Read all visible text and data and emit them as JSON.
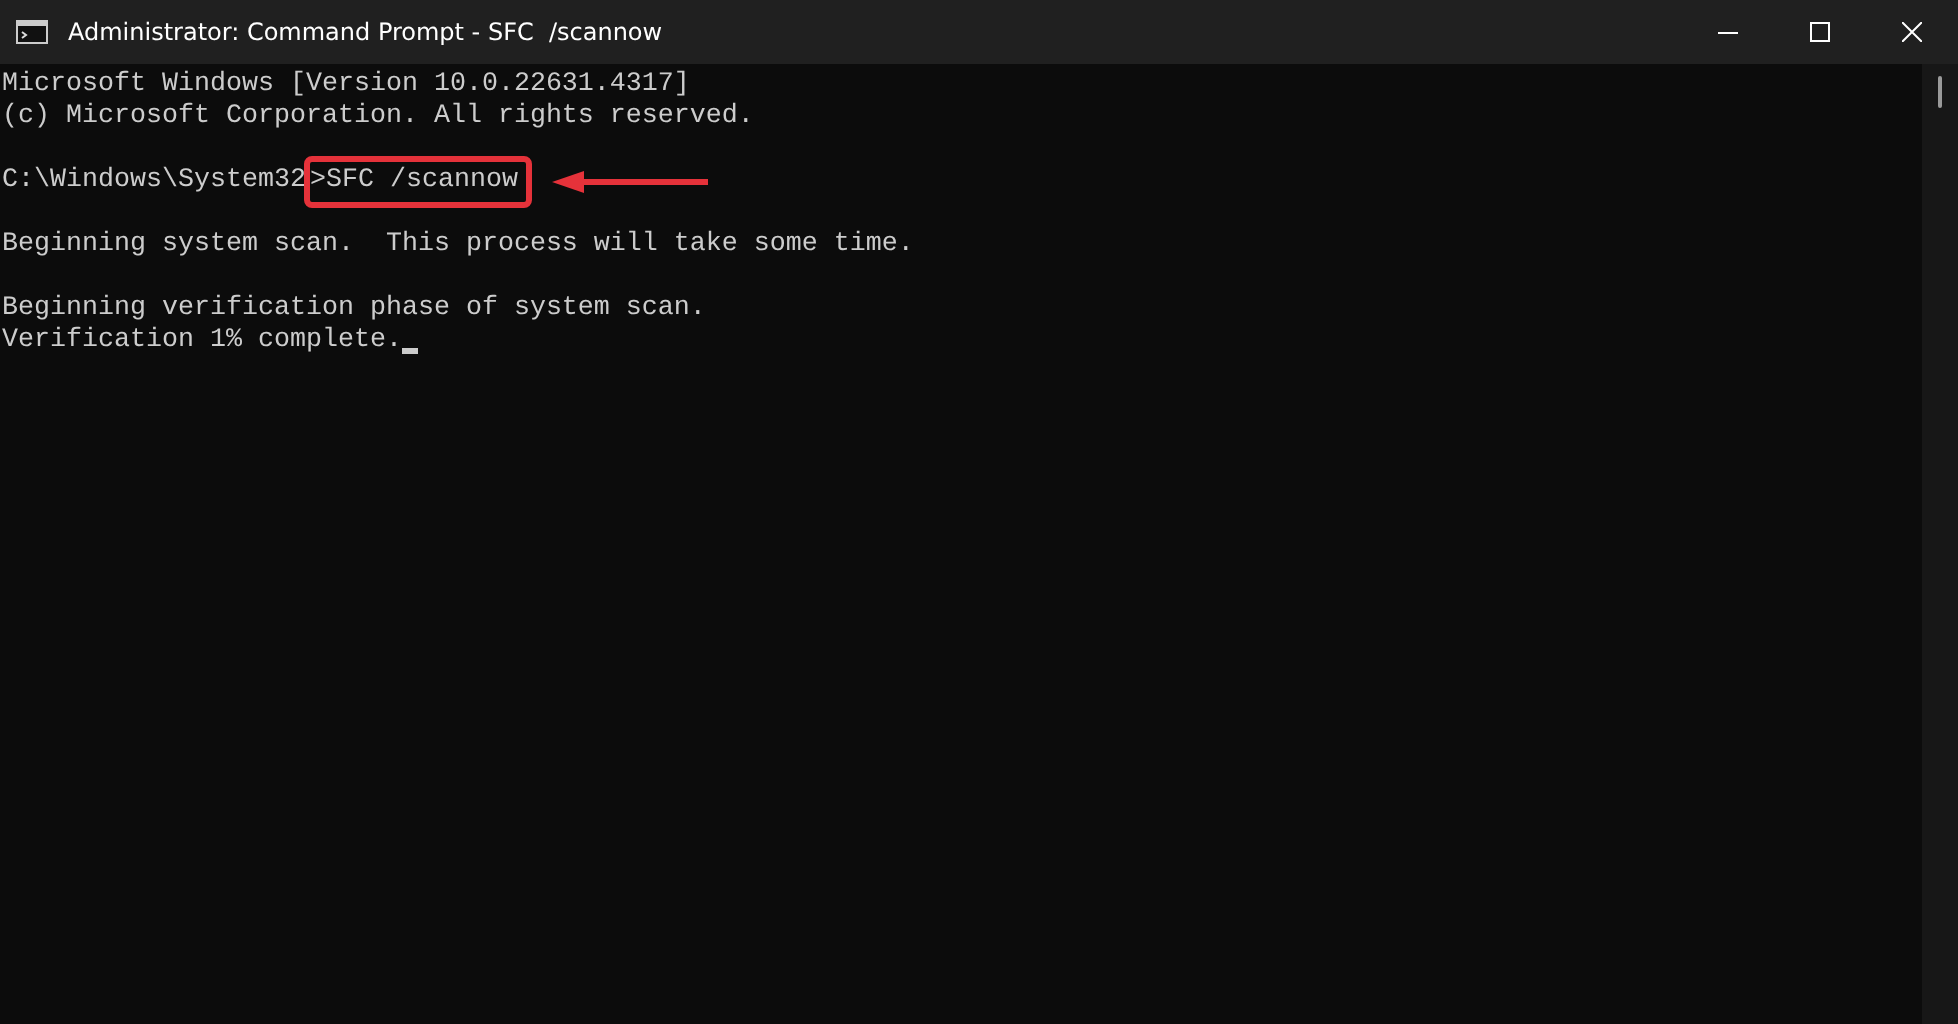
{
  "window": {
    "title": "Administrator: Command Prompt - SFC  /scannow"
  },
  "console": {
    "lines": [
      {
        "kind": "output",
        "text": "Microsoft Windows [Version 10.0.22631.4317]"
      },
      {
        "kind": "output",
        "text": "(c) Microsoft Corporation. All rights reserved."
      },
      {
        "kind": "blank"
      },
      {
        "kind": "prompt",
        "prompt": "C:\\Windows\\System32",
        "command": ">SFC /scannow",
        "highlighted": true
      },
      {
        "kind": "blank"
      },
      {
        "kind": "output",
        "text": "Beginning system scan.  This process will take some time."
      },
      {
        "kind": "blank"
      },
      {
        "kind": "output",
        "text": "Beginning verification phase of system scan."
      },
      {
        "kind": "output",
        "text": "Verification 1% complete.",
        "cursor": true
      }
    ]
  }
}
